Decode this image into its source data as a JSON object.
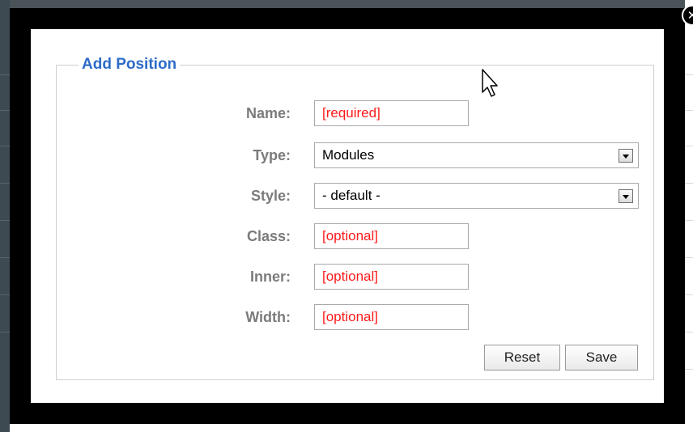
{
  "dialog": {
    "legend": "Add Position",
    "close_glyph": "✕",
    "fields": [
      {
        "label": "Name:",
        "kind": "text",
        "value": "",
        "placeholder": "[required]"
      },
      {
        "label": "Type:",
        "kind": "select",
        "selected": "Modules"
      },
      {
        "label": "Style:",
        "kind": "select",
        "selected": "- default -"
      },
      {
        "label": "Class:",
        "kind": "text",
        "value": "",
        "placeholder": "[optional]"
      },
      {
        "label": "Inner:",
        "kind": "text",
        "value": "",
        "placeholder": "[optional]"
      },
      {
        "label": "Width:",
        "kind": "text",
        "value": "",
        "placeholder": "[optional]"
      }
    ],
    "buttons": {
      "reset_label": "Reset",
      "save_label": "Save"
    }
  },
  "colors": {
    "legend": "#2d6bc8",
    "label": "#7b7b7b",
    "placeholder": "#ff1a1a",
    "modal_frame": "#000000"
  },
  "icons": {
    "close": "close-icon",
    "dropdown": "chevron-down-icon",
    "cursor": "mouse-pointer-icon"
  }
}
